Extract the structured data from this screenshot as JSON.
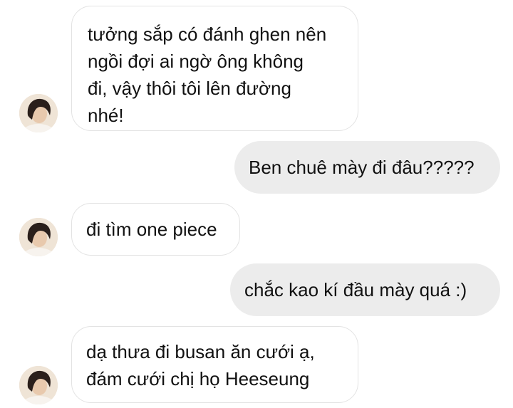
{
  "conversation": {
    "messages": [
      {
        "sender": "other",
        "lines": [
          "tưởng sắp có đánh ghen nên",
          "ngồi đợi ai ngờ ông không",
          "đi, vậy thôi tôi lên đường",
          "nhé!"
        ]
      },
      {
        "sender": "me",
        "lines": [
          "Ben chuê mày đi đâu?????"
        ]
      },
      {
        "sender": "other",
        "lines": [
          "đi tìm one piece"
        ]
      },
      {
        "sender": "me",
        "lines": [
          "chắc kao kí đầu mày quá :)"
        ]
      },
      {
        "sender": "other",
        "lines": [
          "dạ thưa đi busan ăn cưới ạ,",
          "đám cưới chị họ Heeseung"
        ]
      }
    ]
  },
  "colors": {
    "incoming_bubble": "#ffffff",
    "incoming_border": "#e3e3e3",
    "outgoing_bubble": "#ececec",
    "text": "#111111"
  },
  "icons": {
    "avatar": "contact-avatar-photo"
  }
}
